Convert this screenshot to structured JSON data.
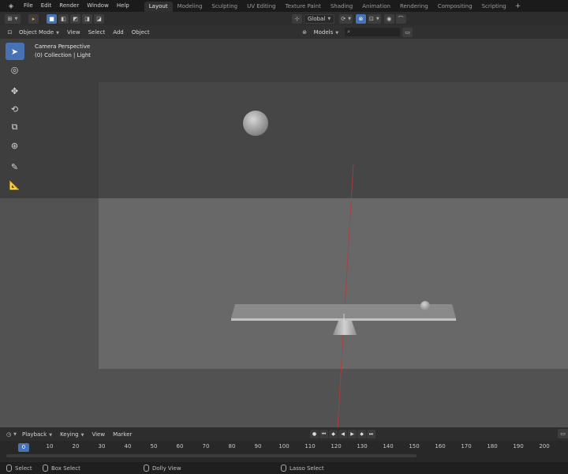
{
  "menubar": {
    "items": [
      "File",
      "Edit",
      "Render",
      "Window",
      "Help"
    ],
    "workspaces": [
      {
        "label": "Layout",
        "active": true
      },
      {
        "label": "Modeling",
        "active": false
      },
      {
        "label": "Sculpting",
        "active": false
      },
      {
        "label": "UV Editing",
        "active": false
      },
      {
        "label": "Texture Paint",
        "active": false
      },
      {
        "label": "Shading",
        "active": false
      },
      {
        "label": "Animation",
        "active": false
      },
      {
        "label": "Rendering",
        "active": false
      },
      {
        "label": "Compositing",
        "active": false
      },
      {
        "label": "Scripting",
        "active": false
      }
    ],
    "add_label": "+"
  },
  "tool_header": {
    "orientation": "Global"
  },
  "viewport_header": {
    "mode": "Object Mode",
    "menus": [
      "View",
      "Select",
      "Add",
      "Object"
    ],
    "collection_filter": "Models"
  },
  "viewport": {
    "view_name": "Camera Perspective",
    "collection_info": "(0) Collection | Light"
  },
  "toolbar": {
    "tools": [
      "select-box",
      "cursor",
      "move",
      "rotate",
      "scale",
      "transform",
      "annotate",
      "measure"
    ],
    "active": "select-box"
  },
  "timeline": {
    "menus": [
      "Playback",
      "Keying",
      "View",
      "Marker"
    ],
    "current_frame": "0",
    "frame_labels": [
      "10",
      "20",
      "30",
      "40",
      "50",
      "60",
      "70",
      "80",
      "90",
      "100",
      "110",
      "120",
      "130",
      "140",
      "150",
      "160",
      "170",
      "180",
      "190",
      "200"
    ]
  },
  "statusbar": {
    "items": [
      "Select",
      "Box Select",
      "Dolly View",
      "Lasso Select"
    ]
  },
  "colors": {
    "accent": "#4772b3",
    "background": "#525252",
    "camera_frame": "#686868"
  }
}
